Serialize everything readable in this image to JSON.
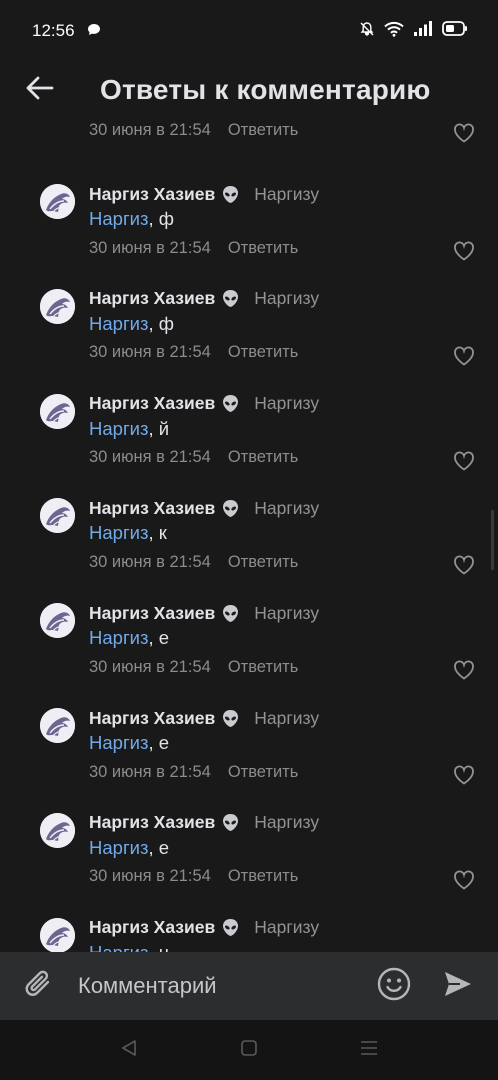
{
  "status": {
    "time": "12:56"
  },
  "header": {
    "title": "Ответы к комментарию"
  },
  "partial_comment": {
    "date": "30 июня в 21:54",
    "reply_label": "Ответить"
  },
  "comments": [
    {
      "author": "Наргиз Хазиев",
      "reply_to": "Наргизу",
      "mention": "Наргиз",
      "text": ", ф",
      "date": "30 июня в 21:54",
      "reply_label": "Ответить"
    },
    {
      "author": "Наргиз Хазиев",
      "reply_to": "Наргизу",
      "mention": "Наргиз",
      "text": ", ф",
      "date": "30 июня в 21:54",
      "reply_label": "Ответить"
    },
    {
      "author": "Наргиз Хазиев",
      "reply_to": "Наргизу",
      "mention": "Наргиз",
      "text": ", й",
      "date": "30 июня в 21:54",
      "reply_label": "Ответить"
    },
    {
      "author": "Наргиз Хазиев",
      "reply_to": "Наргизу",
      "mention": "Наргиз",
      "text": ", к",
      "date": "30 июня в 21:54",
      "reply_label": "Ответить"
    },
    {
      "author": "Наргиз Хазиев",
      "reply_to": "Наргизу",
      "mention": "Наргиз",
      "text": ", е",
      "date": "30 июня в 21:54",
      "reply_label": "Ответить"
    },
    {
      "author": "Наргиз Хазиев",
      "reply_to": "Наргизу",
      "mention": "Наргиз",
      "text": ", е",
      "date": "30 июня в 21:54",
      "reply_label": "Ответить"
    },
    {
      "author": "Наргиз Хазиев",
      "reply_to": "Наргизу",
      "mention": "Наргиз",
      "text": ", е",
      "date": "30 июня в 21:54",
      "reply_label": "Ответить"
    },
    {
      "author": "Наргиз Хазиев",
      "reply_to": "Наргизу",
      "mention": "Наргиз",
      "text": ", ц",
      "date": "",
      "reply_label": ""
    }
  ],
  "composer": {
    "placeholder": "Комментарий"
  },
  "icons": {
    "status": [
      "chat-bubble-icon",
      "mute-bell-icon",
      "wifi-icon",
      "signal-icon",
      "battery-icon"
    ],
    "header": "back-arrow-icon",
    "comment": [
      "avatar",
      "alien-emoji-icon",
      "heart-icon"
    ],
    "composer": [
      "paperclip-icon",
      "smile-icon",
      "send-icon"
    ],
    "nav": [
      "back-triangle-icon",
      "home-square-icon",
      "menu-lines-icon"
    ]
  },
  "colors": {
    "background": "#19191a",
    "mention": "#71aaeb",
    "muted": "#8a8c90",
    "composer_bg": "#2c2d2e"
  }
}
